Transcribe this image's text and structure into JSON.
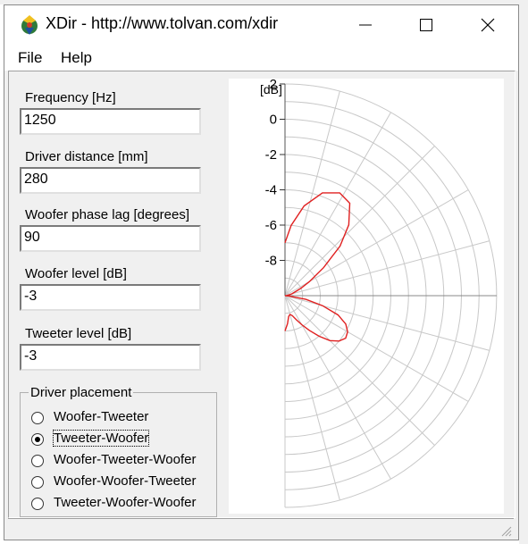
{
  "window": {
    "title": "XDir - http://www.tolvan.com/xdir",
    "minimize_glyph": "—",
    "maximize_glyph": "☐",
    "close_glyph": "✕",
    "icon": "xdir-app-icon"
  },
  "menu": {
    "items": [
      "File",
      "Help"
    ]
  },
  "params": {
    "frequency_label": "Frequency [Hz]",
    "frequency_value": "1250",
    "distance_label": "Driver distance [mm]",
    "distance_value": "280",
    "phase_label": "Woofer phase lag [degrees]",
    "phase_value": "90",
    "woofer_level_label": "Woofer level [dB]",
    "woofer_level_value": "-3",
    "tweeter_level_label": "Tweeter level [dB]",
    "tweeter_level_value": "-3"
  },
  "placement": {
    "title": "Driver placement",
    "options": [
      "Woofer-Tweeter",
      "Tweeter-Woofer",
      "Woofer-Tweeter-Woofer",
      "Woofer-Woofer-Tweeter",
      "Tweeter-Woofer-Woofer"
    ],
    "selected": "Tweeter-Woofer"
  },
  "chart_data": {
    "type": "polar",
    "unit_label": "[dB]",
    "radial_ticks": [
      "2",
      "0",
      "-2",
      "-4",
      "-6",
      "-8"
    ],
    "radial_tick_values": [
      2,
      0,
      -2,
      -4,
      -6,
      -8
    ],
    "radial_range_db": [
      -10,
      2
    ],
    "angle_grid_deg": 15,
    "angle_range_deg": [
      -90,
      90
    ],
    "grid": true,
    "series_color": "#e02020",
    "series": [
      {
        "name": "",
        "points_deg_db": [
          [
            -90,
            -7.0
          ],
          [
            -85,
            -6.0
          ],
          [
            -78,
            -4.8
          ],
          [
            -70,
            -3.8
          ],
          [
            -62,
            -3.4
          ],
          [
            -55,
            -3.6
          ],
          [
            -48,
            -4.6
          ],
          [
            -42,
            -5.8
          ],
          [
            -36,
            -7.3
          ],
          [
            -30,
            -8.4
          ],
          [
            -25,
            -9.0
          ],
          [
            -20,
            -9.4
          ],
          [
            -15,
            -9.6
          ],
          [
            -10,
            -9.8
          ],
          [
            -5,
            -9.9
          ],
          [
            0,
            -10.0
          ],
          [
            5,
            -9.8
          ],
          [
            10,
            -8.8
          ],
          [
            15,
            -7.8
          ],
          [
            20,
            -6.8
          ],
          [
            25,
            -6.2
          ],
          [
            30,
            -5.9
          ],
          [
            35,
            -5.8
          ],
          [
            40,
            -6.0
          ],
          [
            45,
            -6.4
          ],
          [
            50,
            -7.0
          ],
          [
            55,
            -7.6
          ],
          [
            60,
            -8.1
          ],
          [
            65,
            -8.5
          ],
          [
            70,
            -8.8
          ],
          [
            75,
            -8.9
          ],
          [
            80,
            -8.8
          ],
          [
            85,
            -8.4
          ],
          [
            90,
            -8.0
          ]
        ]
      }
    ]
  }
}
